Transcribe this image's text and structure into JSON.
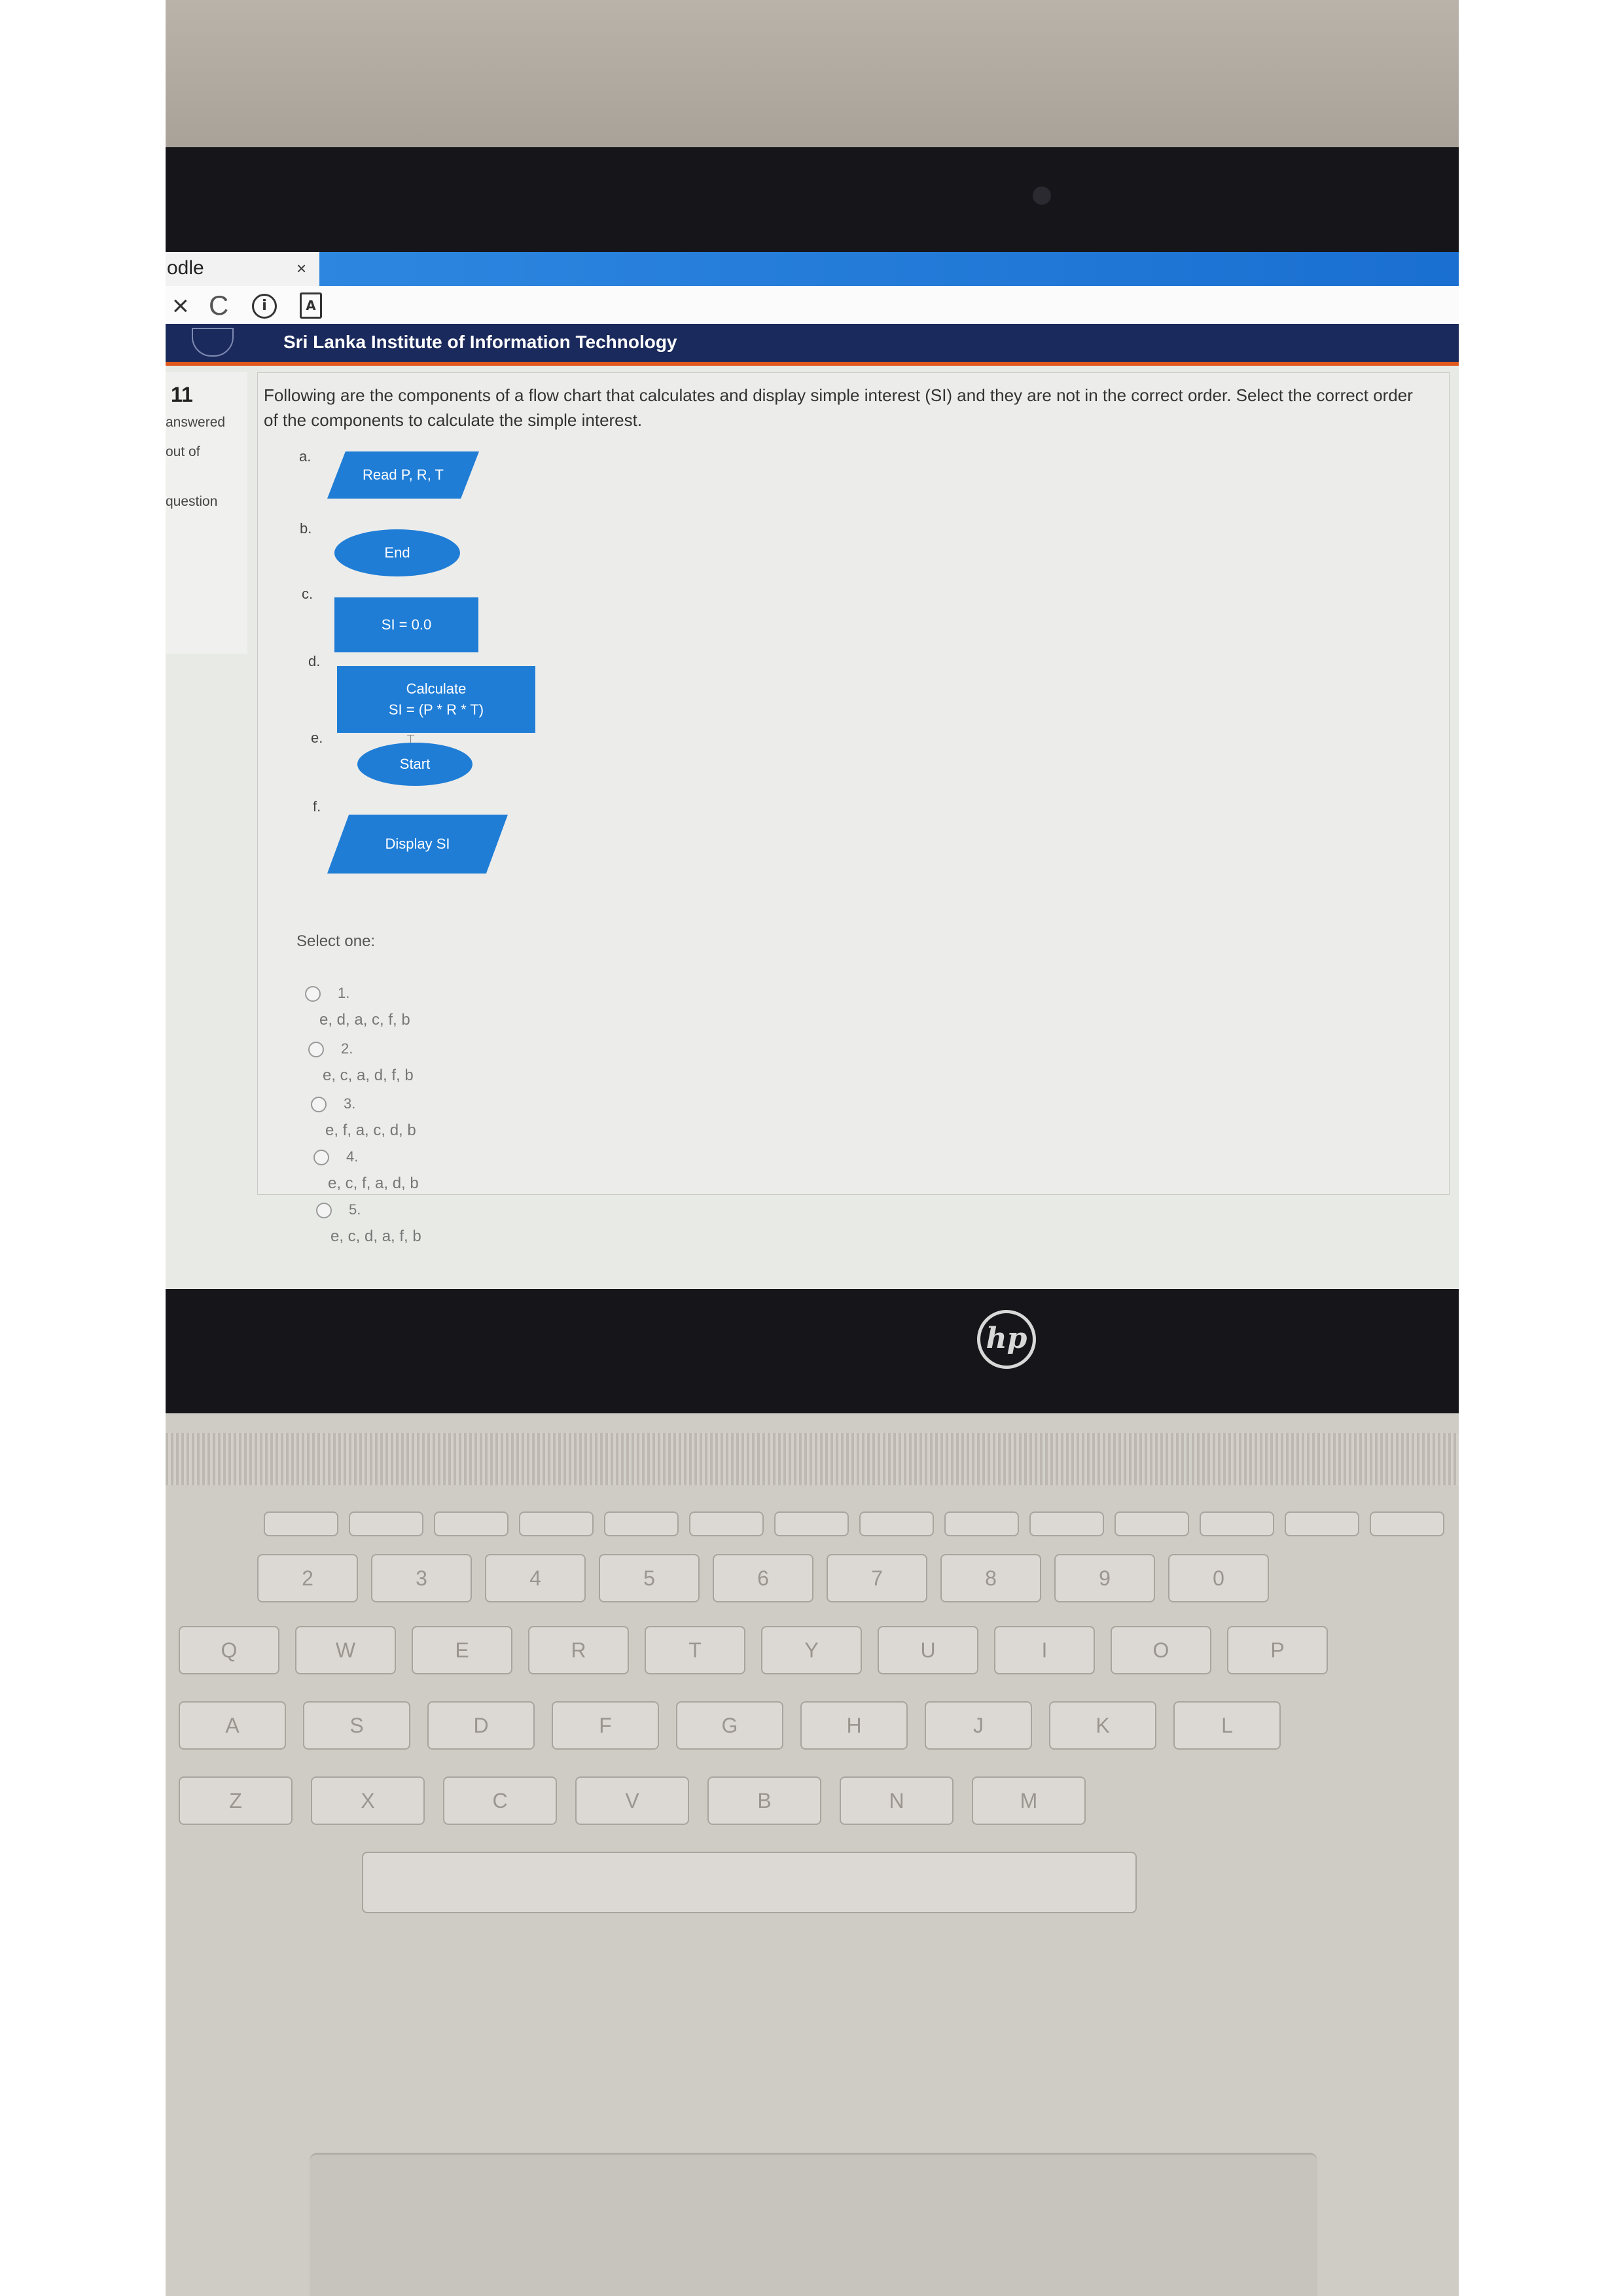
{
  "browser": {
    "tab_title": "odle",
    "tab_close": "×",
    "nav_stop": "×",
    "nav_reload": "C",
    "nav_info": "i",
    "nav_page": "A"
  },
  "site": {
    "name": "Sri Lanka Institute of Information Technology"
  },
  "question_info": {
    "number": "11",
    "status": "answered",
    "marks": "out of",
    "flag": "question"
  },
  "question": {
    "text": "Following are the components of a flow chart that calculates and display simple interest (SI) and they are not in the correct order. Select the correct order of the components to calculate the simple interest.",
    "components": [
      {
        "letter": "a.",
        "label": "Read P, R, T",
        "shape": "parallelogram"
      },
      {
        "letter": "b.",
        "label": "End",
        "shape": "ellipse"
      },
      {
        "letter": "c.",
        "label": "SI = 0.0",
        "shape": "rectangle"
      },
      {
        "letter": "d.",
        "label": "Calculate\nSI = (P * R * T)",
        "shape": "rectangle"
      },
      {
        "letter": "e.",
        "label": "Start",
        "shape": "ellipse"
      },
      {
        "letter": "f.",
        "label": "Display SI",
        "shape": "parallelogram"
      }
    ],
    "select_label": "Select one:",
    "answers": [
      {
        "num": "1.",
        "text": "e, d, a, c, f, b"
      },
      {
        "num": "2.",
        "text": "e, c, a, d, f, b"
      },
      {
        "num": "3.",
        "text": "e, f, a, c, d, b"
      },
      {
        "num": "4.",
        "text": "e, c, f, a, d, b"
      },
      {
        "num": "5.",
        "text": "e, c, d, a, f, b"
      }
    ]
  },
  "laptop": {
    "brand": "hp",
    "row1": [
      "2",
      "3",
      "4",
      "5",
      "6",
      "7",
      "8",
      "9",
      "0"
    ],
    "row2": [
      "Q",
      "W",
      "E",
      "R",
      "T",
      "Y",
      "U",
      "I",
      "O",
      "P"
    ],
    "row3": [
      "A",
      "S",
      "D",
      "F",
      "G",
      "H",
      "J",
      "K",
      "L"
    ],
    "row4": [
      "Z",
      "X",
      "C",
      "V",
      "B",
      "N",
      "M"
    ]
  },
  "colors": {
    "shape_fill": "#1f7dd6",
    "site_header": "#1b2a5c",
    "tab_accent": "#2d87e0"
  }
}
